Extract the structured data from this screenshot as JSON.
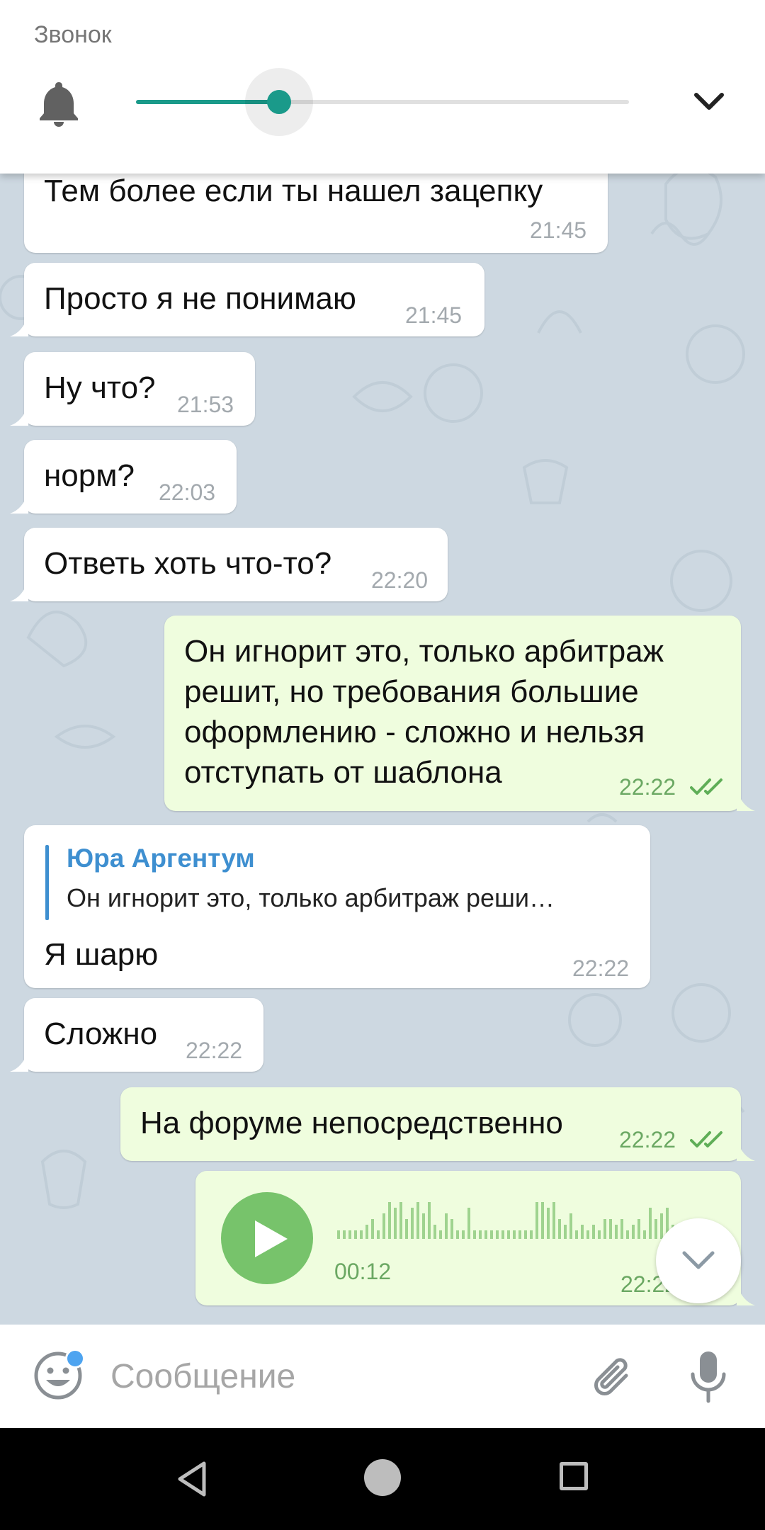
{
  "volume_panel": {
    "title": "Звонок",
    "level": 0.29,
    "accent": "#1a9a8a"
  },
  "messages": [
    {
      "dir": "in",
      "text": "Тем более если ты нашел зацепку",
      "time": "21:45"
    },
    {
      "dir": "in",
      "text": "Просто я не понимаю",
      "time": "21:45"
    },
    {
      "dir": "in",
      "text": "Ну что?",
      "time": "21:53"
    },
    {
      "dir": "in",
      "text": "норм?",
      "time": "22:03"
    },
    {
      "dir": "in",
      "text": "Ответь хоть что-то?",
      "time": "22:20"
    },
    {
      "dir": "out",
      "lines": [
        "Он игнорит это, только арбитраж",
        "решит, но требования большие",
        "оформлению - сложно и нельзя",
        "отступать от шаблона"
      ],
      "time": "22:22",
      "status": "read"
    },
    {
      "dir": "in",
      "reply_name": "Юра Аргентум",
      "reply_text": "Он игнорит это, только арбитраж реши…",
      "text": "Я шарю",
      "time": "22:22"
    },
    {
      "dir": "in",
      "text": "Сложно",
      "time": "22:22"
    },
    {
      "dir": "out",
      "text": "На форуме непосредственно",
      "time": "22:22",
      "status": "read"
    },
    {
      "dir": "out",
      "type": "voice",
      "duration": "00:12",
      "time": "22:22"
    }
  ],
  "input": {
    "placeholder": "Сообщение"
  },
  "colors": {
    "incoming_bg": "#ffffff",
    "outgoing_bg": "#effdde",
    "chat_bg": "#cdd8e1",
    "link": "#3e8fd0",
    "out_time": "#6ba863"
  },
  "icons": [
    "bell-icon",
    "chevron-down-icon",
    "read-checks-icon",
    "play-icon",
    "emoji-icon",
    "attach-icon",
    "mic-icon",
    "nav-back-icon",
    "nav-home-icon",
    "nav-recent-icon"
  ]
}
